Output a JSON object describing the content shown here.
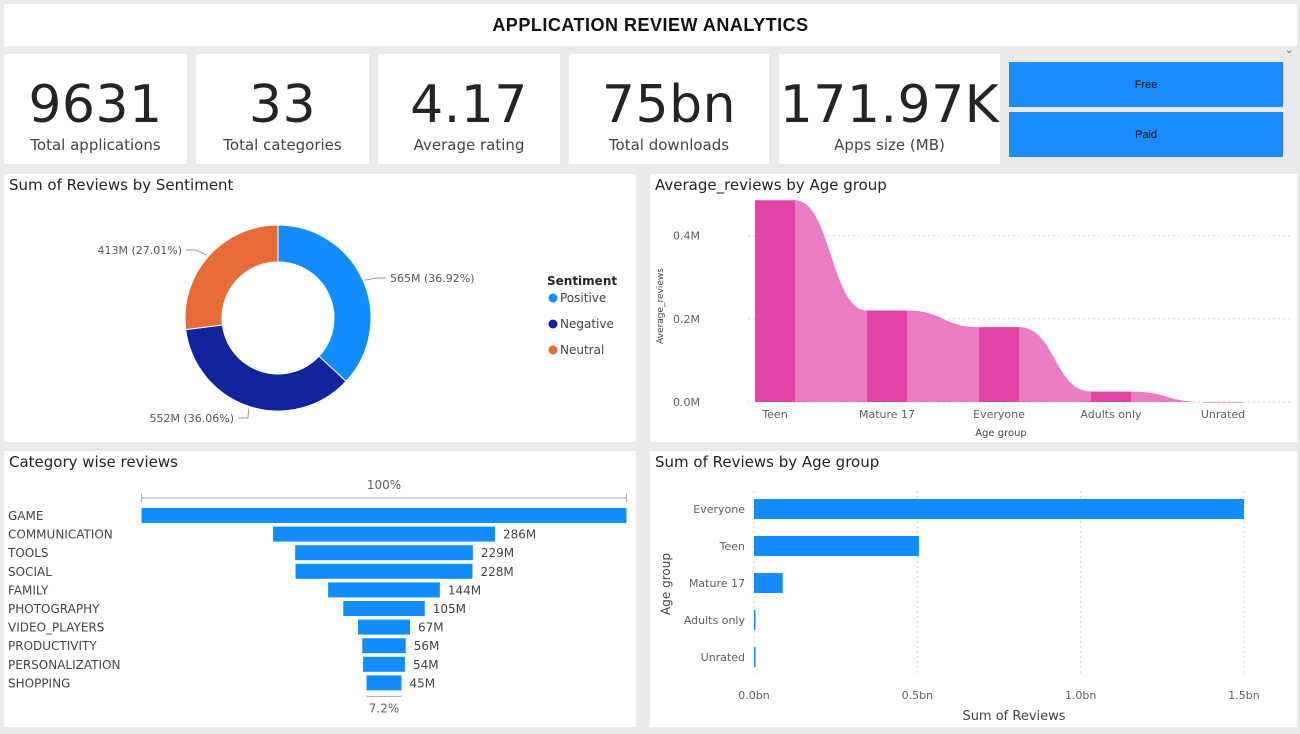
{
  "header": {
    "title": "APPLICATION REVIEW ANALYTICS"
  },
  "kpis": [
    {
      "value": "9631",
      "label": "Total applications"
    },
    {
      "value": "33",
      "label": "Total categories"
    },
    {
      "value": "4.17",
      "label": "Average rating"
    },
    {
      "value": "75bn",
      "label": "Total downloads"
    },
    {
      "value": "171.97K",
      "label": "Apps size (MB)"
    }
  ],
  "slicer": {
    "options": [
      "Free",
      "Paid"
    ],
    "accent": "#1a8cff"
  },
  "colors": {
    "positive": "#118dff",
    "negative": "#12239e",
    "neutral": "#e66c37",
    "magenta_dark": "#e044a7",
    "magenta_light": "#e97cc3",
    "bar": "#118dff"
  },
  "panels": {
    "sentiment": {
      "title": "Sum of Reviews by Sentiment"
    },
    "avg_age": {
      "title": "Average_reviews by Age group"
    },
    "category": {
      "title": "Category wise reviews"
    },
    "sum_age": {
      "title": "Sum of Reviews by Age group"
    }
  },
  "chart_data": [
    {
      "type": "pie",
      "variant": "donut",
      "title": "Sum of Reviews by Sentiment",
      "legend_title": "Sentiment",
      "legend_position": "right",
      "slices": [
        {
          "name": "Positive",
          "value": 565,
          "label": "565M (36.92%)",
          "color": "#118dff"
        },
        {
          "name": "Negative",
          "value": 552,
          "label": "552M (36.06%)",
          "color": "#12239e"
        },
        {
          "name": "Neutral",
          "value": 413,
          "label": "413M (27.01%)",
          "color": "#e66c37"
        }
      ]
    },
    {
      "type": "area",
      "variant": "ribbon",
      "title": "Average_reviews by Age group",
      "xlabel": "Age group",
      "ylabel": "Average_reviews",
      "categories": [
        "Teen",
        "Mature 17",
        "Everyone",
        "Adults only",
        "Unrated"
      ],
      "values": [
        0.485,
        0.22,
        0.18,
        0.025,
        0.0
      ],
      "unit": "M",
      "yticks": [
        "0.0M",
        "0.2M",
        "0.4M"
      ],
      "ylim": [
        0,
        0.5
      ],
      "grid": true
    },
    {
      "type": "bar",
      "variant": "funnel",
      "title": "Category wise reviews",
      "categories": [
        "GAME",
        "COMMUNICATION",
        "TOOLS",
        "SOCIAL",
        "FAMILY",
        "PHOTOGRAPHY",
        "VIDEO_PLAYERS",
        "PRODUCTIVITY",
        "PERSONALIZATION",
        "SHOPPING"
      ],
      "values": [
        625,
        286,
        229,
        228,
        144,
        105,
        67,
        56,
        54,
        45
      ],
      "value_labels": [
        "",
        "286M",
        "229M",
        "228M",
        "144M",
        "105M",
        "67M",
        "56M",
        "54M",
        "45M"
      ],
      "top_label": "100%",
      "bottom_label": "7.2%"
    },
    {
      "type": "bar",
      "orientation": "horizontal",
      "title": "Sum of Reviews by Age group",
      "xlabel": "Sum of Reviews",
      "ylabel": "Age group",
      "categories": [
        "Everyone",
        "Teen",
        "Mature 17",
        "Adults only",
        "Unrated"
      ],
      "values": [
        1.5,
        0.505,
        0.088,
        0.004,
        0.001
      ],
      "unit": "bn",
      "xticks": [
        "0.0bn",
        "0.5bn",
        "1.0bn",
        "1.5bn"
      ],
      "xlim": [
        0,
        1.5
      ],
      "grid": true
    }
  ]
}
